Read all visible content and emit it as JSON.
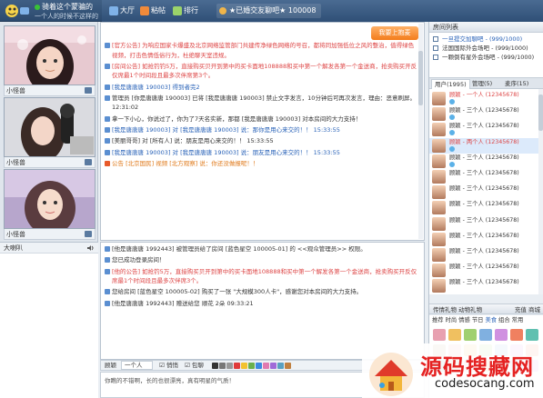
{
  "header": {
    "user_name": "骑着这个蒙骗的",
    "user_sub": "一个人的时候不这样的",
    "nav": [
      "大厅",
      "粘帖",
      "排行"
    ],
    "room": "★已婚交友聊吧★ 100008"
  },
  "left": {
    "videos": [
      {
        "label": "小怪兽"
      },
      {
        "label": "小怪兽"
      },
      {
        "label": "小怪兽"
      }
    ],
    "speaker_panel": "大喇叭"
  },
  "chat": {
    "follow_button": "我要上抱麦",
    "top_messages": [
      "[官方公告] 为响应国家卡爆盛及北京网络监管部门共建传净绿色网络的号召，都将同加强低位之风的整治，值得绿色视频，打击色情低俗行为，杜绝聊天室违规。",
      "[房间公告] 如抢钓钓5万，直接购买贝开到第中的买卡面地108888和买中第一个解发各第一个金送商，抢卖购买开反仅席最1个时间段且最多次伴席第3个。",
      "[我是唐唐唐 190003] 得到者完2",
      "管理员 [你是唐唐唐 190003] 已将 [我是唐唐唐 190003] 禁止文字发言，10分钟后可再次发言，理由：恶意刷屏。 12:31:02",
      "拿一下小心，你说过了，你为了7天名实新，那都 [我是唐唐唐 190003] 对本房间的大力支持！",
      "[我是唐唐唐 190003] 对 [我是唐唐唐 190003] 说：那你是用心来交的！！ 15:33:55",
      "[美丽哥哥] 对 [所有人] 说：朋友是用心来交的！！ 15:33:55",
      "[我是唐唐唐 190003] 对 [我是唐唐唐 190003] 说：朋友是用心来交的！！ 15:33:55",
      "公告 [北京国民] 视频 [北方观察] 说：你还没做报呢！！"
    ],
    "bottom_messages": [
      "[他是唐唐唐 1992443] 被管理员给了房间 [蓝色星空 100005-01] 的 <<观众管理员>> 权限。",
      "您已成功登录房间！",
      "[他的公告] 如抢钓5万，直接购买贝开到第中的买卡面地108888和买中第一个解发各第一个金送商，抢卖购买开反仅席最1个时间段且最多次伴席3个。",
      "您给房间 [蓝色星空 100005-02] 购买了一张 \"大规模300人卡\"，感谢您对本房间的大力支持。",
      "[他是唐唐唐 1992443] 赠送给您 顺花 2朵 09:33:21"
    ],
    "input_bar": {
      "to_label": "顾颖",
      "to_value": "一个人",
      "private": "悄悄",
      "chat_mode": "包聊"
    },
    "input_text": "你瞧的不错啊，长的也很漂亮，真有明星的气质！"
  },
  "right": {
    "rooms_title": "房间列表",
    "rooms": [
      "一旦提交加聊吧 - (999/1000)",
      "法国国际外会场吧 - (999/1000)",
      "一颗倒有星外会场吧 - (999/1000)"
    ],
    "tabs": [
      "用户(1995)",
      "管理(5)",
      "麦序(15)"
    ],
    "users": [
      {
        "name": "顾颖 - 一个人 (12345678)"
      },
      {
        "name": "顾颖 - 三个人 (12345678)"
      },
      {
        "name": "顾颖 - 三个人 (12345678)"
      },
      {
        "name": "顾颖 - 两个人 (12345678)"
      },
      {
        "name": "顾颖 - 三个人 (12345678)"
      },
      {
        "name": "顾颖 - 三个人 (12345678)"
      },
      {
        "name": "顾颖 - 三个人 (12345678)"
      },
      {
        "name": "顾颖 - 三个人 (12345678)"
      },
      {
        "name": "顾颖 - 三个人 (12345678)"
      },
      {
        "name": "顾颖 - 三个人 (12345678)"
      },
      {
        "name": "顾颖 - 三个人 (12345678)"
      },
      {
        "name": "顾颖 - 三个人 (12345678)"
      },
      {
        "name": "顾颖 - 三个人 (12345678)"
      }
    ],
    "gift_title": "传情礼物 动物礼物",
    "gift_right": "充值 商城",
    "gift_cats": [
      "推荐",
      "时尚",
      "情感",
      "节日",
      "美食",
      "组合",
      "常用"
    ]
  },
  "watermark": {
    "text": "源码搜藏网",
    "url": "codesocang.com"
  }
}
